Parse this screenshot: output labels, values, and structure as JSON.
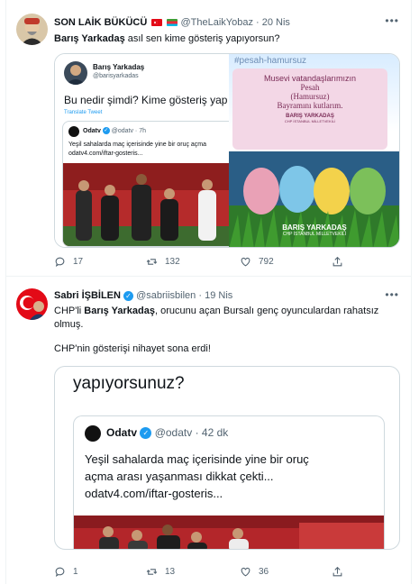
{
  "tweet1": {
    "display_name": "SON LAİK BÜKÜCÜ",
    "handle": "@TheLaikYobaz",
    "time": "20 Nis",
    "text_bold": "Barış Yarkadaş",
    "text_rest": " asıl sen kime gösteriş yapıyorsun?",
    "quoted": {
      "name": "Barış Yarkadaş",
      "handle": "@barisyarkadas",
      "text": "Bu nedir şimdi? Kime gösteriş yap",
      "translate": "Translate Tweet",
      "inner_name": "Odatv",
      "inner_handle": "@odatv · 7h",
      "inner_text_1": "Yeşil sahalarda maç içerisinde yine bir oruç açma",
      "inner_text_2": "odatv4.com/iftar-gosteris..."
    },
    "poster": {
      "hashtag": "#pesah-hamursuz",
      "line1": "Musevi vatandaşlarımızın",
      "line2": "Pesah",
      "line3": "(Hamursuz)",
      "line4": "Bayramını kutlarım.",
      "name": "BARIŞ YARKADAŞ",
      "sub": "CHP İSTANBUL MİLLETVEKİLİ",
      "name2": "BARIŞ YARKADAŞ",
      "sub2": "CHP İSTANBUL MİLLETVEKİLİ"
    },
    "replies": "17",
    "retweets": "132",
    "likes": "792"
  },
  "tweet2": {
    "display_name": "Sabri İŞBİLEN",
    "handle": "@sabriisbilen",
    "time": "19 Nis",
    "text_a": "CHP'li ",
    "text_bold": "Barış Yarkadaş",
    "text_b": ", orucunu açan Bursalı genç oyunculardan rahatsız",
    "text_c": "olmuş.",
    "text_d": "CHP'nin gösterişi nihayet sona erdi!",
    "media": {
      "top_text": "yapıyorsunuz?",
      "inner_name": "Odatv",
      "inner_handle": "@odatv · 42 dk",
      "inner_text_1": "Yeşil sahalarda maç içerisinde yine bir oruç",
      "inner_text_2": "açma arası yaşanması dikkat çekti...",
      "inner_text_3": "odatv4.com/iftar-gosteris..."
    },
    "replies": "1",
    "retweets": "13",
    "likes": "36"
  },
  "icons": [
    "more-icon",
    "reply-icon",
    "retweet-icon",
    "like-icon",
    "share-icon",
    "verified-icon",
    "flag-tr-icon",
    "flag-az-icon"
  ]
}
